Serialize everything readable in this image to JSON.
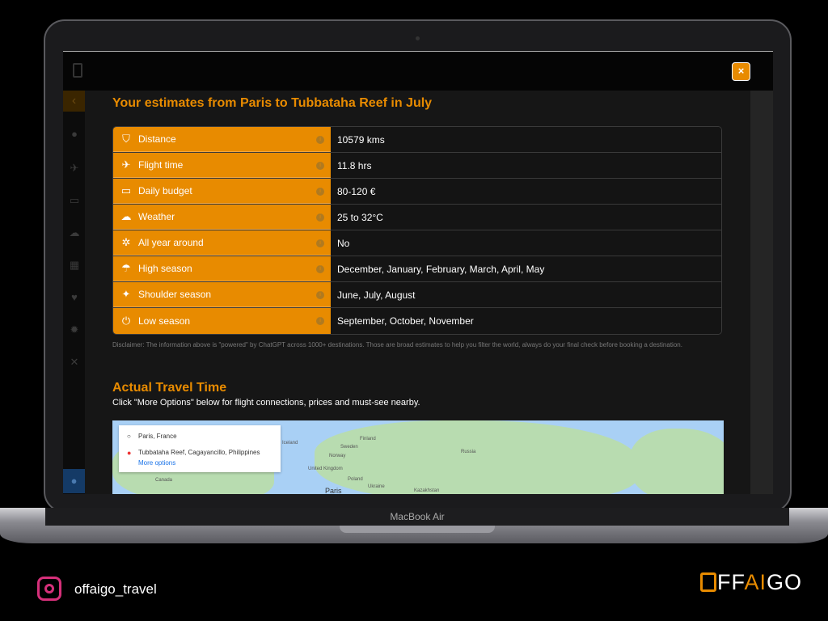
{
  "modal": {
    "title": "Your estimates from Paris to Tubbataha Reef in July",
    "close_label": "×"
  },
  "estimates": [
    {
      "icon": "binoculars-icon",
      "label": "Distance",
      "value": "10579 kms"
    },
    {
      "icon": "plane-departure-icon",
      "label": "Flight time",
      "value": "11.8 hrs"
    },
    {
      "icon": "credit-card-icon",
      "label": "Daily budget",
      "value": "80-120 €"
    },
    {
      "icon": "cloud-icon",
      "label": "Weather",
      "value": "25 to 32°C"
    },
    {
      "icon": "life-ring-icon",
      "label": "All year around",
      "value": "No"
    },
    {
      "icon": "umbrella-beach-icon",
      "label": "High season",
      "value": "December, January, February, March, April, May"
    },
    {
      "icon": "maple-leaf-icon",
      "label": "Shoulder season",
      "value": "June, July, August"
    },
    {
      "icon": "power-icon",
      "label": "Low season",
      "value": "September, October, November"
    }
  ],
  "disclaimer": "Disclaimer: The information above is \"powered\" by ChatGPT across 1000+ destinations. Those are broad estimates to help you filter the world, always do your final check before booking a destination.",
  "travel": {
    "title": "Actual Travel Time",
    "subtitle": "Click \"More Options\" below for flight connections, prices and must-see nearby."
  },
  "map": {
    "origin": "Paris, France",
    "destination": "Tubbataha Reef, Cagayancillo, Philippines",
    "more_options": "More options",
    "labels": [
      "Iceland",
      "Finland",
      "Sweden",
      "Norway",
      "Russia",
      "United Kingdom",
      "Poland",
      "Ukraine",
      "Canada",
      "Kazakhstan",
      "Paris"
    ]
  },
  "laptop": {
    "model": "MacBook Air"
  },
  "footer": {
    "instagram": "offaigo_travel",
    "brand": "OFFAIGO",
    "brand_parts": [
      "FF",
      "AI",
      "GO"
    ]
  },
  "colors": {
    "accent": "#e88b00"
  }
}
